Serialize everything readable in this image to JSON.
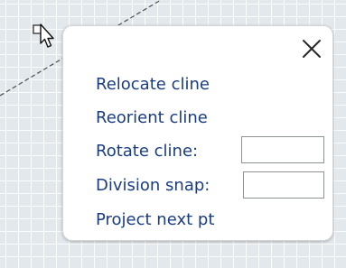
{
  "background": {
    "grid_color": "#ffffff",
    "canvas_color": "#e3e8ec",
    "cline_color": "#4a4f55"
  },
  "cursor": {
    "icon": "arrow-pointer-icon"
  },
  "popup": {
    "close_icon": "close-x-icon",
    "text_color": "#1a3c82",
    "items": {
      "relocate": "Relocate cline",
      "reorient": "Reorient cline",
      "rotate": "Rotate cline:",
      "division": "Division snap:",
      "project": "Project next pt"
    },
    "fields": {
      "rotate_value": "",
      "division_value": ""
    }
  }
}
